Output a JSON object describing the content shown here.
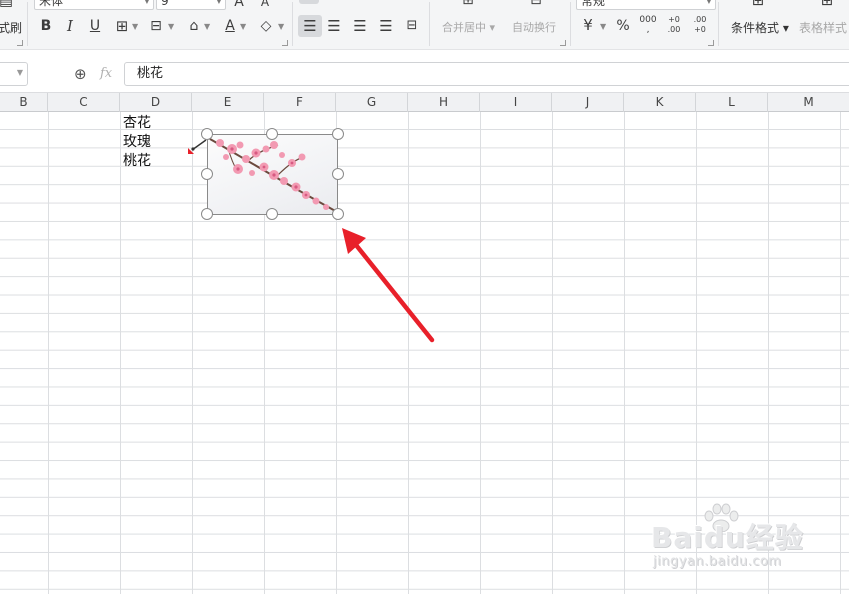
{
  "ribbon": {
    "format_painter_label": "式刷",
    "font_name": "宋体",
    "font_size": "9",
    "bold_label": "B",
    "italic_label": "I",
    "underline_label": "U",
    "merge_center_label": "合并居中",
    "wrap_text_label": "自动换行",
    "number_format": "常规",
    "percent_label": "%",
    "conditional_format_label": "条件格式",
    "table_style_label": "表格样式"
  },
  "formula_bar": {
    "fx_label": "fx",
    "value": "桃花"
  },
  "columns": [
    "B",
    "C",
    "D",
    "E",
    "F",
    "G",
    "H",
    "I",
    "J",
    "K",
    "L",
    "M"
  ],
  "cells": {
    "d1": "杏花",
    "d2": "玫瑰",
    "d3": "桃花"
  },
  "watermark": {
    "brand": "Baidu经验",
    "url": "jingyan.baidu.com"
  },
  "colors": {
    "arrow": "#e8202a",
    "ribbon_bg": "#f4f5f6",
    "grid_line": "#dcdee1",
    "blossom": "#f29ab2"
  }
}
